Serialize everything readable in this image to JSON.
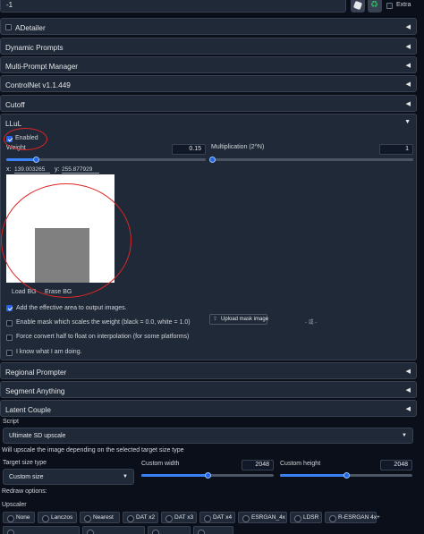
{
  "top": {
    "seed_value": "-1",
    "extra_label": "Extra",
    "dice_icon": "dice-icon",
    "recycle_icon": "recycle-icon"
  },
  "accordions": [
    {
      "label": "ADetailer"
    },
    {
      "label": "Dynamic Prompts"
    },
    {
      "label": "Multi-Prompt Manager"
    },
    {
      "label": "ControlNet v1.1.449"
    },
    {
      "label": "Cutoff"
    }
  ],
  "llul": {
    "title": "LLuL",
    "enabled_label": "Enabled",
    "enabled": true,
    "weight_label": "Weight",
    "weight_value": "0.15",
    "weight_fraction": 0.15,
    "multiplication_label": "Multiplication (2^N)",
    "multiplication_value": "1",
    "multiplication_fraction": 0,
    "x_label": "x:",
    "x_value": "139.003265",
    "y_label": "y:",
    "y_value": "255.877929",
    "load_bg": "Load BG",
    "erase_bg": "Erase BG",
    "add_effective_area": "Add the effective area to output images.",
    "enable_mask": "Enable mask which scales the weight (black = 0.0, white = 1.0)",
    "upload_mask": "Upload mask image",
    "mask_dash": "- 或 -",
    "force_convert": "Force convert half to float on interpolation (for some platforms)",
    "i_know": "I know what I am doing."
  },
  "accordions2": [
    {
      "label": "Regional Prompter"
    },
    {
      "label": "Segment Anything"
    },
    {
      "label": "Latent Couple"
    }
  ],
  "script": {
    "label": "Script",
    "selected": "Ultimate SD upscale",
    "info": "Will upscale the image depending on the selected target size type",
    "target_size_label": "Target size type",
    "target_size_value": "Custom size",
    "custom_width_label": "Custom width",
    "custom_width_value": "2048",
    "custom_width_fraction": 0.5,
    "custom_height_label": "Custom height",
    "custom_height_value": "2048",
    "custom_height_fraction": 0.5,
    "redraw_label": "Redraw options:",
    "upscaler_label": "Upscaler",
    "upscalers": [
      "None",
      "Lanczos",
      "Nearest",
      "DAT x2",
      "DAT x3",
      "DAT x4",
      "ESRGAN_4x",
      "LDSR",
      "R-ESRGAN 4x+"
    ]
  },
  "colors": {
    "accent": "#2563eb",
    "annotation": "#dc2626",
    "panel": "#1f2937",
    "background": "#0b0f19"
  }
}
